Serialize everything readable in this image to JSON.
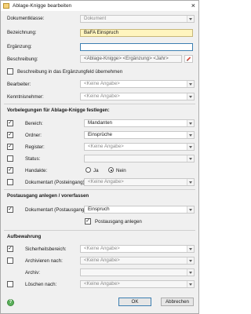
{
  "window": {
    "title": "Ablage-Knigge bearbeiten",
    "close_glyph": "×"
  },
  "general": {
    "dokumentklasse_label": "Dokumentklasse:",
    "dokumentklasse_value": "Dokument",
    "bezeichnung_label": "Bezeichnung:",
    "bezeichnung_value": "BaFA Einspruch",
    "ergaenzung_label": "Ergänzung:",
    "ergaenzung_value": "",
    "beschreibung_label": "Beschreibung:",
    "beschreibung_value": "<Ablage-Knigge> <Ergänzung> <Jahr>",
    "uebernehmen_label": "Beschreibung in das Ergänzungfeld übernehmen",
    "bearbeiter_label": "Bearbeiter:",
    "bearbeiter_value": "<Keine Angabe>",
    "kenntnisnehmer_label": "Kenntnisnehmer:",
    "kenntnisnehmer_value": "<Keine Angabe>"
  },
  "vorbelegungen": {
    "heading": "Vorbelegungen für Ablage-Knigge festlegen:",
    "bereich_label": "Bereich:",
    "bereich_value": "Mandanten",
    "ordner_label": "Ordner:",
    "ordner_value": "Einsprüche",
    "register_label": "Register:",
    "register_value": "<Keine Angabe>",
    "status_label": "Status:",
    "status_value": "",
    "handakte_label": "Handakte:",
    "ja_label": "Ja",
    "nein_label": "Nein",
    "handakte_selected": "Nein",
    "dokumentart_label": "Dokumentart (Posteingang):",
    "dokumentart_value": "<Keine Angabe>"
  },
  "postausgang": {
    "heading": "Postausgang anlegen / vorerfassen",
    "dokumentart_label": "Dokumentart (Postausgang):",
    "dokumentart_value": "Einspruch",
    "anlegen_label": "Postausgang anlegen"
  },
  "aufbewahrung": {
    "heading": "Aufbewahrung",
    "sicherheit_label": "Sicherheitsbereich:",
    "sicherheit_value": "<Keine Angabe>",
    "archivieren_label": "Archivieren nach:",
    "archivieren_value": "<Keine Angabe>",
    "archiv_label": "Archiv:",
    "archiv_value": "",
    "loeschen_label": "Löschen nach:",
    "loeschen_value": "<Keine Angabe>"
  },
  "buttons": {
    "ok_label": "OK",
    "cancel_label": "Abbrechen"
  },
  "checkmark": "✓",
  "icons": {
    "edit": "pencil-icon",
    "help": "help-icon",
    "app": "folder-icon"
  },
  "colors": {
    "highlight_field": "#fff5bf",
    "focus_border": "#3c7fb1",
    "help_green": "#5cb15c"
  }
}
